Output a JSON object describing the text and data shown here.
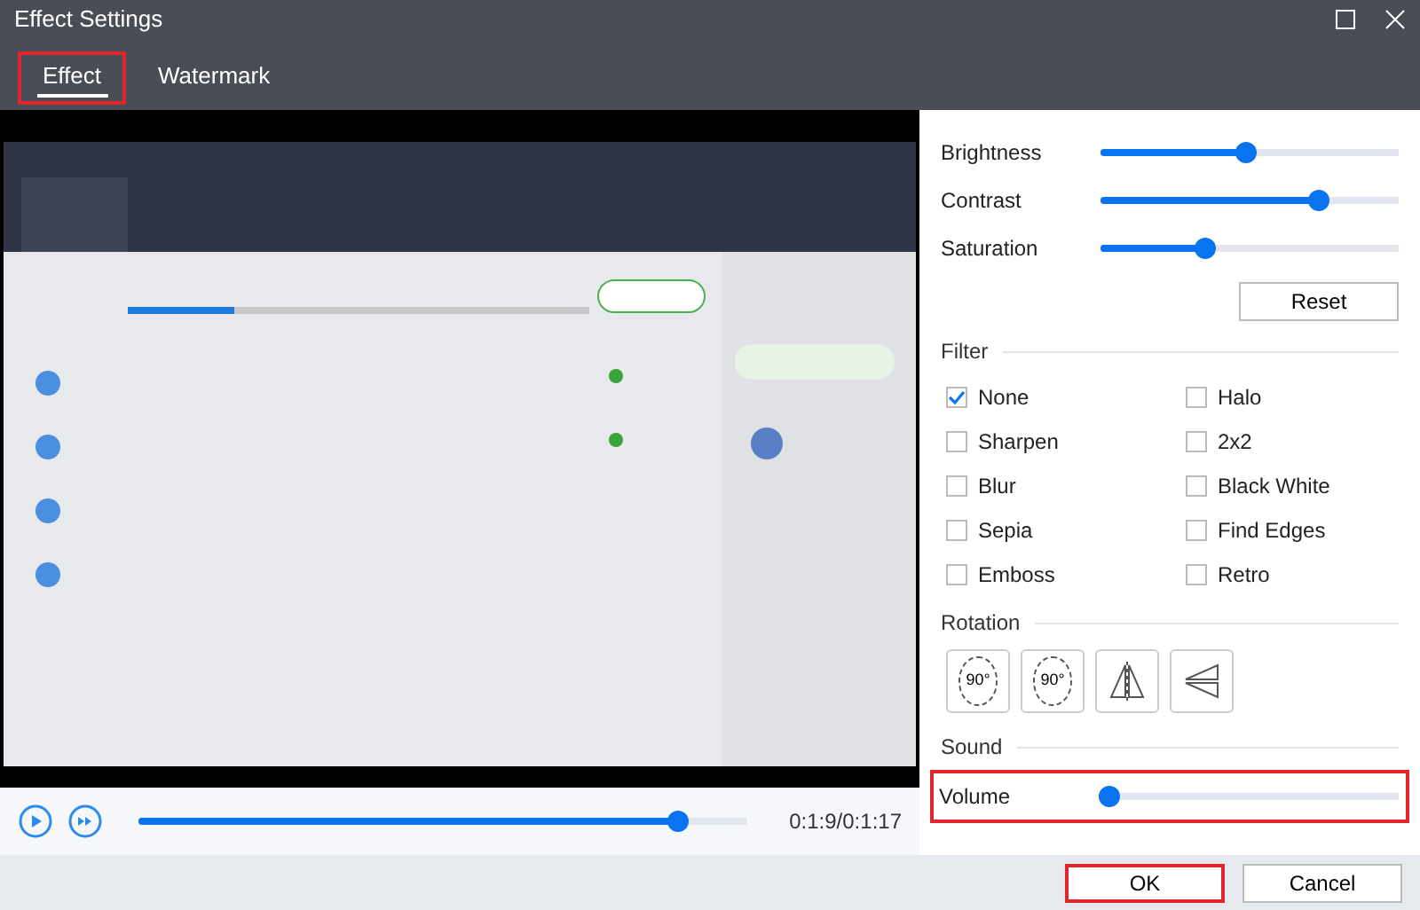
{
  "window": {
    "title": "Effect Settings"
  },
  "tabs": [
    {
      "label": "Effect",
      "selected": true,
      "annotated": true
    },
    {
      "label": "Watermark",
      "selected": false,
      "annotated": false
    }
  ],
  "player": {
    "level": 0.9,
    "time": "0:1:9/0:1:17"
  },
  "adjustments": [
    {
      "label": "Brightness",
      "level": 0.49
    },
    {
      "label": "Contrast",
      "level": 0.75
    },
    {
      "label": "Saturation",
      "level": 0.34
    }
  ],
  "reset_button": "Reset",
  "filter": {
    "title": "Filter",
    "options": [
      {
        "label": "None",
        "checked": true
      },
      {
        "label": "Halo",
        "checked": false
      },
      {
        "label": "Sharpen",
        "checked": false
      },
      {
        "label": "2x2",
        "checked": false
      },
      {
        "label": "Blur",
        "checked": false
      },
      {
        "label": "Black White",
        "checked": false
      },
      {
        "label": "Sepia",
        "checked": false
      },
      {
        "label": "Find Edges",
        "checked": false
      },
      {
        "label": "Emboss",
        "checked": false
      },
      {
        "label": "Retro",
        "checked": false
      }
    ]
  },
  "rotation": {
    "title": "Rotation",
    "buttons": [
      {
        "kind": "rotate-left",
        "label": "90°"
      },
      {
        "kind": "rotate-right",
        "label": "90°"
      },
      {
        "kind": "flip-horizontal"
      },
      {
        "kind": "flip-vertical"
      }
    ]
  },
  "sound": {
    "title": "Sound",
    "label": "Volume",
    "level": 0.0,
    "annotated": true
  },
  "buttons": [
    {
      "label": "OK",
      "annotated": true
    },
    {
      "label": "Cancel",
      "annotated": false
    }
  ]
}
